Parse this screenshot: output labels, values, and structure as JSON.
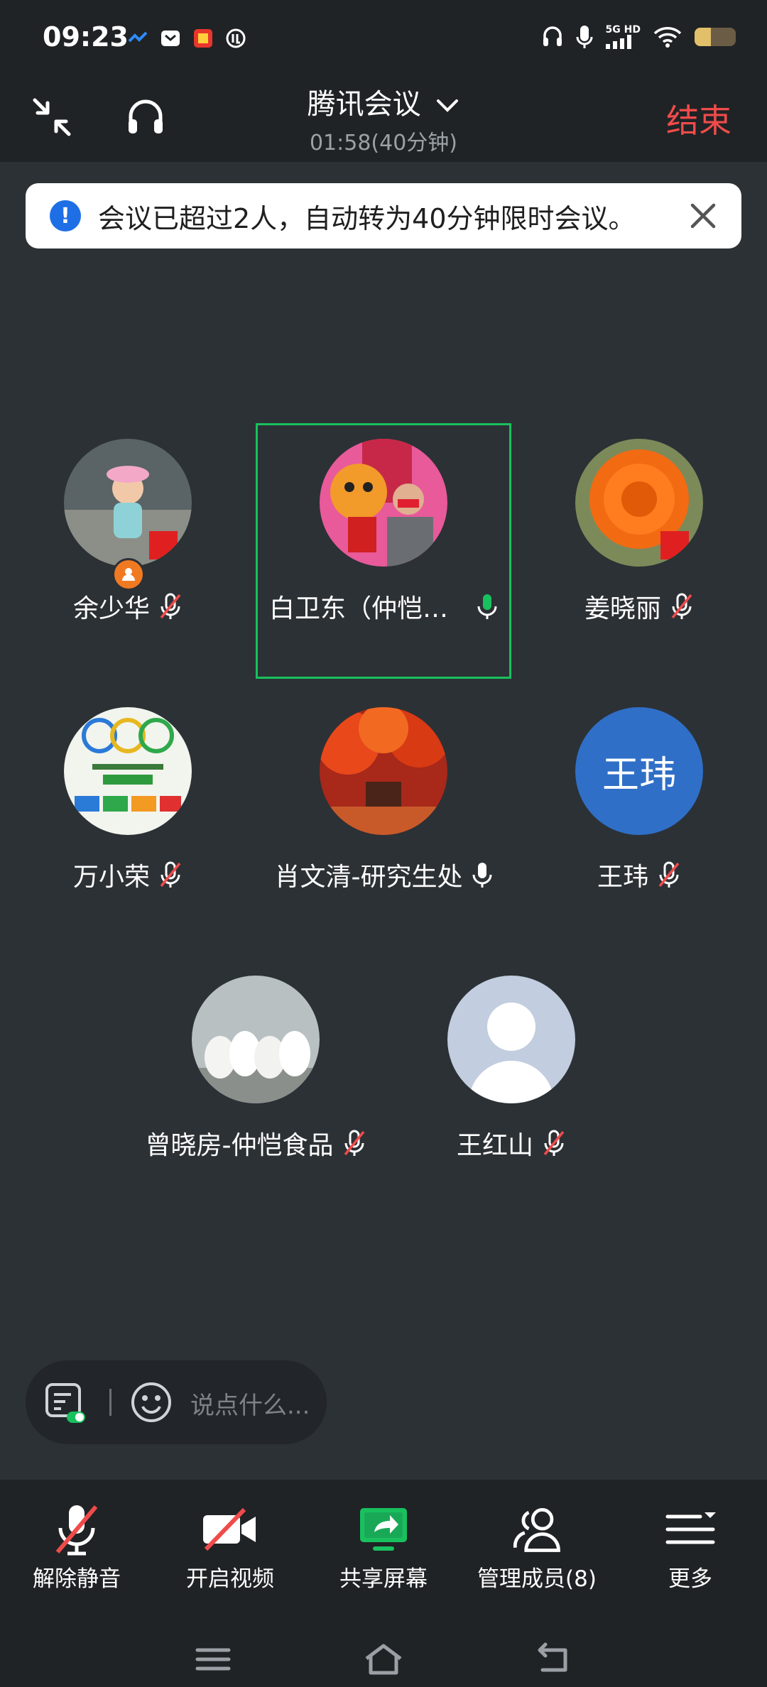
{
  "status_bar": {
    "time": "09:23",
    "network": "5G HD",
    "battery_level": 0.4
  },
  "header": {
    "title": "腾讯会议",
    "timer": "01:58(40分钟)",
    "end_label": "结束"
  },
  "banner": {
    "message": "会议已超过2人，自动转为40分钟限时会议。"
  },
  "participants": [
    {
      "name": "余少华",
      "mic": "muted",
      "avatar": "photo-child",
      "host": true
    },
    {
      "name": "白卫东（仲恺研…",
      "mic": "active",
      "avatar": "photo-tiger-man",
      "speaking": true
    },
    {
      "name": "姜晓丽",
      "mic": "muted",
      "avatar": "photo-orange-flower"
    },
    {
      "name": "万小荣",
      "mic": "muted",
      "avatar": "photo-poster"
    },
    {
      "name": "肖文清-研究生处",
      "mic": "on",
      "avatar": "photo-red-trees"
    },
    {
      "name": "王玮",
      "mic": "muted",
      "avatar": "initials",
      "initials": "王玮",
      "avatar_color": "#2f6fc7"
    },
    {
      "name": "曾晓房-仲恺食品",
      "mic": "muted",
      "avatar": "photo-pigeons"
    },
    {
      "name": "王红山",
      "mic": "muted",
      "avatar": "default-person"
    }
  ],
  "chat": {
    "placeholder": "说点什么..."
  },
  "toolbar": {
    "unmute": "解除静音",
    "video": "开启视频",
    "share": "共享屏幕",
    "members": "管理成员(8)",
    "more": "更多"
  },
  "colors": {
    "end": "#f04b4b",
    "active_border": "#18c15e",
    "share_icon": "#18c15e",
    "accent_blue": "#1e6fe6"
  }
}
